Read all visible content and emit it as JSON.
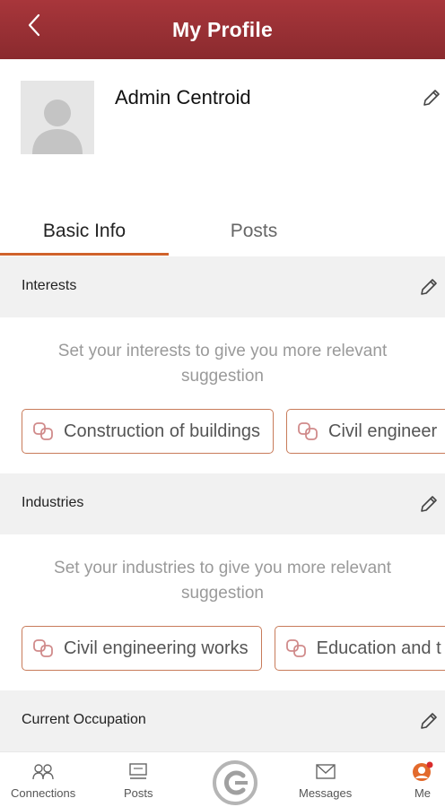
{
  "header": {
    "title": "My Profile"
  },
  "profile": {
    "name": "Admin Centroid"
  },
  "tabs": [
    {
      "label": "Basic Info",
      "active": true
    },
    {
      "label": "Posts",
      "active": false
    }
  ],
  "interests": {
    "label": "Interests",
    "hint": "Set your interests to give you more relevant suggestion",
    "chips": [
      "Construction of buildings",
      "Civil engineer"
    ]
  },
  "industries": {
    "label": "Industries",
    "hint": "Set your industries to give you more relevant suggestion",
    "chips": [
      "Civil engineering works",
      "Education and t"
    ]
  },
  "occupation": {
    "label": "Current Occupation"
  },
  "nav": {
    "connections": "Connections",
    "posts": "Posts",
    "messages": "Messages",
    "me": "Me"
  },
  "colors": {
    "header": "#8a2a2e",
    "accent": "#d0622b",
    "chip_border": "#c87b5a",
    "section_bg": "#f1f1f1"
  }
}
